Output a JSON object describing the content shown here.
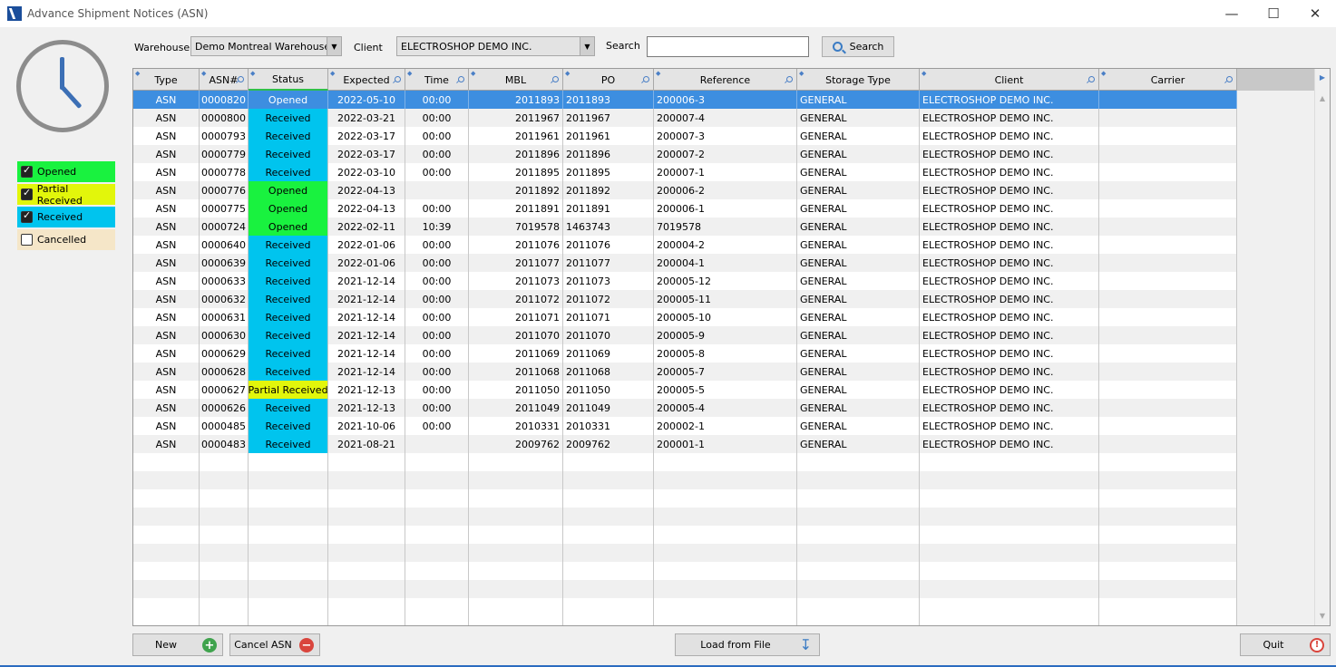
{
  "window": {
    "title": "Advance Shipment Notices (ASN)"
  },
  "legend": [
    {
      "label": "Opened",
      "checked": true,
      "color": "#19f23f"
    },
    {
      "label": "Partial Received",
      "checked": true,
      "color": "#e2f60b"
    },
    {
      "label": "Received",
      "checked": true,
      "color": "#00c4ee"
    },
    {
      "label": "Cancelled",
      "checked": false,
      "color": "#f5e6c8"
    }
  ],
  "filters": {
    "warehouse_label": "Warehouse",
    "warehouse_value": "Demo Montreal Warehouse",
    "client_label": "Client",
    "client_value": "ELECTROSHOP DEMO INC.",
    "search_label": "Search",
    "search_value": "",
    "search_button": "Search"
  },
  "grid": {
    "columns": [
      "Type",
      "ASN#",
      "Status",
      "Expected",
      "Time",
      "MBL",
      "PO",
      "Reference",
      "Storage Type",
      "Client",
      "Carrier"
    ],
    "rows": [
      [
        "ASN",
        "0000820",
        "Opened",
        "2022-05-10",
        "00:00",
        "2011893",
        "2011893",
        "200006-3",
        "GENERAL",
        "ELECTROSHOP DEMO INC.",
        ""
      ],
      [
        "ASN",
        "0000800",
        "Received",
        "2022-03-21",
        "00:00",
        "2011967",
        "2011967",
        "200007-4",
        "GENERAL",
        "ELECTROSHOP DEMO INC.",
        ""
      ],
      [
        "ASN",
        "0000793",
        "Received",
        "2022-03-17",
        "00:00",
        "2011961",
        "2011961",
        "200007-3",
        "GENERAL",
        "ELECTROSHOP DEMO INC.",
        ""
      ],
      [
        "ASN",
        "0000779",
        "Received",
        "2022-03-17",
        "00:00",
        "2011896",
        "2011896",
        "200007-2",
        "GENERAL",
        "ELECTROSHOP DEMO INC.",
        ""
      ],
      [
        "ASN",
        "0000778",
        "Received",
        "2022-03-10",
        "00:00",
        "2011895",
        "2011895",
        "200007-1",
        "GENERAL",
        "ELECTROSHOP DEMO INC.",
        ""
      ],
      [
        "ASN",
        "0000776",
        "Opened",
        "2022-04-13",
        "",
        "2011892",
        "2011892",
        "200006-2",
        "GENERAL",
        "ELECTROSHOP DEMO INC.",
        ""
      ],
      [
        "ASN",
        "0000775",
        "Opened",
        "2022-04-13",
        "00:00",
        "2011891",
        "2011891",
        "200006-1",
        "GENERAL",
        "ELECTROSHOP DEMO INC.",
        ""
      ],
      [
        "ASN",
        "0000724",
        "Opened",
        "2022-02-11",
        "10:39",
        "7019578",
        "1463743",
        "7019578",
        "GENERAL",
        "ELECTROSHOP DEMO INC.",
        ""
      ],
      [
        "ASN",
        "0000640",
        "Received",
        "2022-01-06",
        "00:00",
        "2011076",
        "2011076",
        "200004-2",
        "GENERAL",
        "ELECTROSHOP DEMO INC.",
        ""
      ],
      [
        "ASN",
        "0000639",
        "Received",
        "2022-01-06",
        "00:00",
        "2011077",
        "2011077",
        "200004-1",
        "GENERAL",
        "ELECTROSHOP DEMO INC.",
        ""
      ],
      [
        "ASN",
        "0000633",
        "Received",
        "2021-12-14",
        "00:00",
        "2011073",
        "2011073",
        "200005-12",
        "GENERAL",
        "ELECTROSHOP DEMO INC.",
        ""
      ],
      [
        "ASN",
        "0000632",
        "Received",
        "2021-12-14",
        "00:00",
        "2011072",
        "2011072",
        "200005-11",
        "GENERAL",
        "ELECTROSHOP DEMO INC.",
        ""
      ],
      [
        "ASN",
        "0000631",
        "Received",
        "2021-12-14",
        "00:00",
        "2011071",
        "2011071",
        "200005-10",
        "GENERAL",
        "ELECTROSHOP DEMO INC.",
        ""
      ],
      [
        "ASN",
        "0000630",
        "Received",
        "2021-12-14",
        "00:00",
        "2011070",
        "2011070",
        "200005-9",
        "GENERAL",
        "ELECTROSHOP DEMO INC.",
        ""
      ],
      [
        "ASN",
        "0000629",
        "Received",
        "2021-12-14",
        "00:00",
        "2011069",
        "2011069",
        "200005-8",
        "GENERAL",
        "ELECTROSHOP DEMO INC.",
        ""
      ],
      [
        "ASN",
        "0000628",
        "Received",
        "2021-12-14",
        "00:00",
        "2011068",
        "2011068",
        "200005-7",
        "GENERAL",
        "ELECTROSHOP DEMO INC.",
        ""
      ],
      [
        "ASN",
        "0000627",
        "Partial Received",
        "2021-12-13",
        "00:00",
        "2011050",
        "2011050",
        "200005-5",
        "GENERAL",
        "ELECTROSHOP DEMO INC.",
        ""
      ],
      [
        "ASN",
        "0000626",
        "Received",
        "2021-12-13",
        "00:00",
        "2011049",
        "2011049",
        "200005-4",
        "GENERAL",
        "ELECTROSHOP DEMO INC.",
        ""
      ],
      [
        "ASN",
        "0000485",
        "Received",
        "2021-10-06",
        "00:00",
        "2010331",
        "2010331",
        "200002-1",
        "GENERAL",
        "ELECTROSHOP DEMO INC.",
        ""
      ],
      [
        "ASN",
        "0000483",
        "Received",
        "2021-08-21",
        "",
        "2009762",
        "2009762",
        "200001-1",
        "GENERAL",
        "ELECTROSHOP DEMO INC.",
        ""
      ]
    ],
    "selected_row": 0
  },
  "buttons": {
    "new": "New",
    "cancel_asn": "Cancel ASN",
    "load_from_file": "Load from File",
    "quit": "Quit"
  }
}
